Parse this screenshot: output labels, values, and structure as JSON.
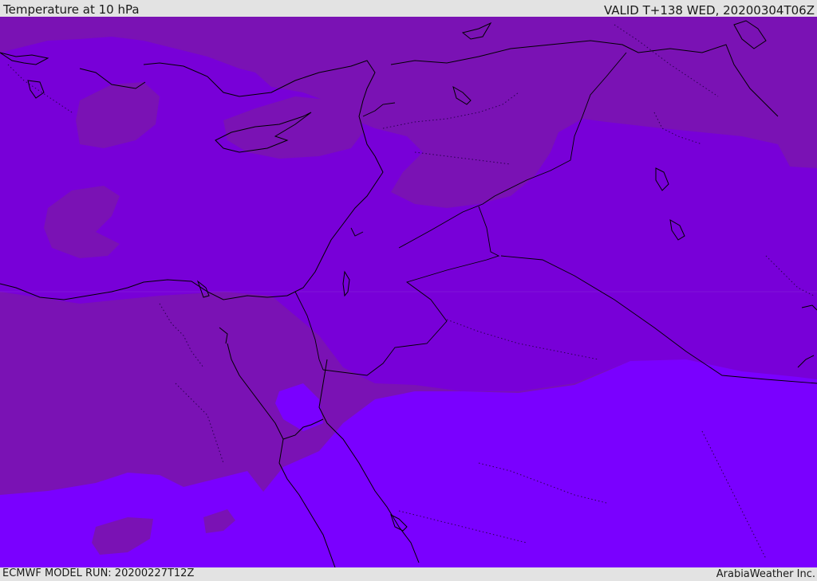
{
  "header": {
    "title": "Temperature at 10 hPa",
    "valid_time": "VALID T+138 WED, 20200304T06Z"
  },
  "footer": {
    "model_run": "ECMWF MODEL RUN: 20200227T12Z",
    "credit": "ArabiaWeather Inc."
  },
  "map": {
    "variable": "temperature",
    "pressure_level": "10 hPa",
    "region": "Eastern Mediterranean / Middle East",
    "colors": {
      "band_cold": "#7a12b4",
      "band_mid": "#7800d8",
      "band_warm": "#7a00ff",
      "coastline": "#000000",
      "borders_dotted": "#2a0050"
    }
  }
}
